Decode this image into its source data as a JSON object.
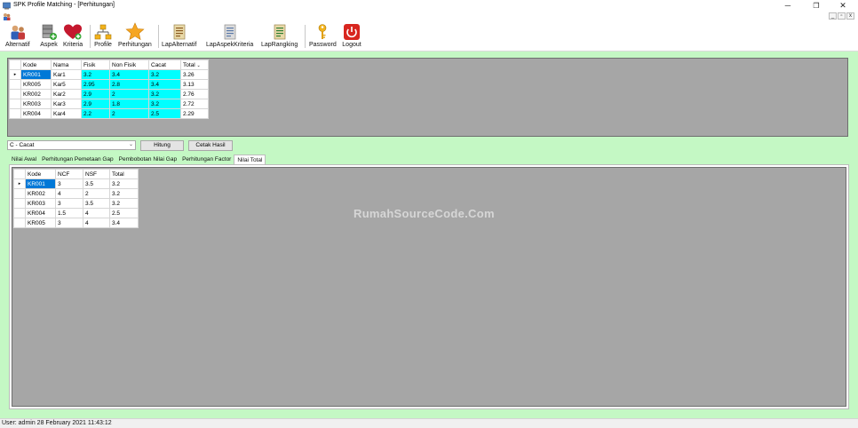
{
  "window": {
    "title": "SPK Profile Matching - [Perhitungan]",
    "controls": {
      "minimize": "─",
      "maximize": "❐",
      "close": "✕"
    },
    "child_controls": [
      "_",
      "▫",
      "x"
    ]
  },
  "toolbar": {
    "items": [
      {
        "label": "Alternatif",
        "icon": "people-icon"
      },
      {
        "label": "Aspek",
        "icon": "server-add-icon"
      },
      {
        "label": "Kriteria",
        "icon": "heart-icon"
      },
      {
        "label": "Profile",
        "icon": "hierarchy-icon"
      },
      {
        "label": "Perhitungan",
        "icon": "star-icon"
      },
      {
        "label": "LapAlternatif",
        "icon": "report-icon"
      },
      {
        "label": "LapAspekKriteria",
        "icon": "report-icon"
      },
      {
        "label": "LapRangking",
        "icon": "report-icon"
      },
      {
        "label": "Password",
        "icon": "key-icon"
      },
      {
        "label": "Logout",
        "icon": "power-icon"
      }
    ]
  },
  "top_grid": {
    "columns": [
      "Kode",
      "Nama",
      "Fisik",
      "Non Fisik",
      "Cacat",
      "Total"
    ],
    "rows": [
      [
        "KR001",
        "Kar1",
        "3.2",
        "3.4",
        "3.2",
        "3.26"
      ],
      [
        "KR005",
        "Kar5",
        "2.95",
        "2.8",
        "3.4",
        "3.13"
      ],
      [
        "KR002",
        "Kar2",
        "2.9",
        "2",
        "3.2",
        "2.76"
      ],
      [
        "KR003",
        "Kar3",
        "2.9",
        "1.8",
        "3.2",
        "2.72"
      ],
      [
        "KR004",
        "Kar4",
        "2.2",
        "2",
        "2.5",
        "2.29"
      ]
    ],
    "sort_glyph": "⌄",
    "row_marker": "▸"
  },
  "controls": {
    "aspect_combo": "C - Cacat",
    "combo_arrow": "⌄",
    "hitung_label": "Hitung",
    "cetak_label": "Cetak Hasil"
  },
  "tabs": [
    "Nilai Awal",
    "Perhitungan Pemetaan Gap",
    "Pembobotan Nilai Gap",
    "Perhitungan Factor",
    "Nilai Total"
  ],
  "bottom_grid": {
    "columns": [
      "Kode",
      "NCF",
      "NSF",
      "Total"
    ],
    "rows": [
      [
        "KR001",
        "3",
        "3.5",
        "3.2"
      ],
      [
        "KR002",
        "4",
        "2",
        "3.2"
      ],
      [
        "KR003",
        "3",
        "3.5",
        "3.2"
      ],
      [
        "KR004",
        "1.5",
        "4",
        "2.5"
      ],
      [
        "KR005",
        "3",
        "4",
        "3.4"
      ]
    ],
    "row_marker": "▸"
  },
  "watermark": "RumahSourceCode.Com",
  "status": {
    "text": "User: admin  28 February 2021 11:43:12"
  },
  "colors": {
    "main_bg": "#c4f8c4",
    "grid_bg": "#a6a6a6",
    "cyan": "#00ffff",
    "selection": "#0078d7"
  }
}
